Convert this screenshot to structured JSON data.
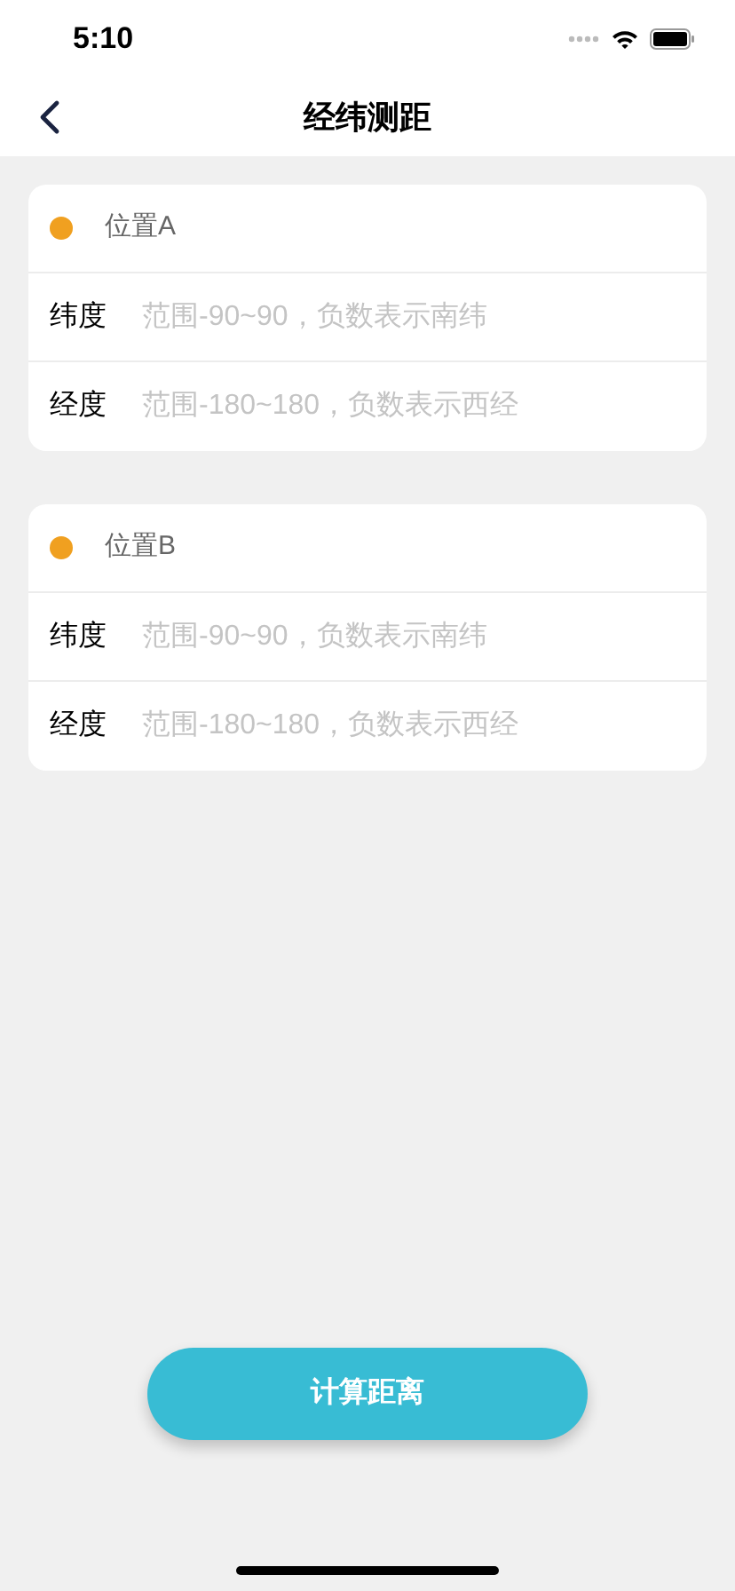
{
  "status_bar": {
    "time": "5:10"
  },
  "nav": {
    "title": "经纬测距"
  },
  "locations": [
    {
      "name": "位置A",
      "fields": [
        {
          "label": "纬度",
          "placeholder": "范围-90~90，负数表示南纬"
        },
        {
          "label": "经度",
          "placeholder": "范围-180~180，负数表示西经"
        }
      ]
    },
    {
      "name": "位置B",
      "fields": [
        {
          "label": "纬度",
          "placeholder": "范围-90~90，负数表示南纬"
        },
        {
          "label": "经度",
          "placeholder": "范围-180~180，负数表示西经"
        }
      ]
    }
  ],
  "button": "计算距离"
}
